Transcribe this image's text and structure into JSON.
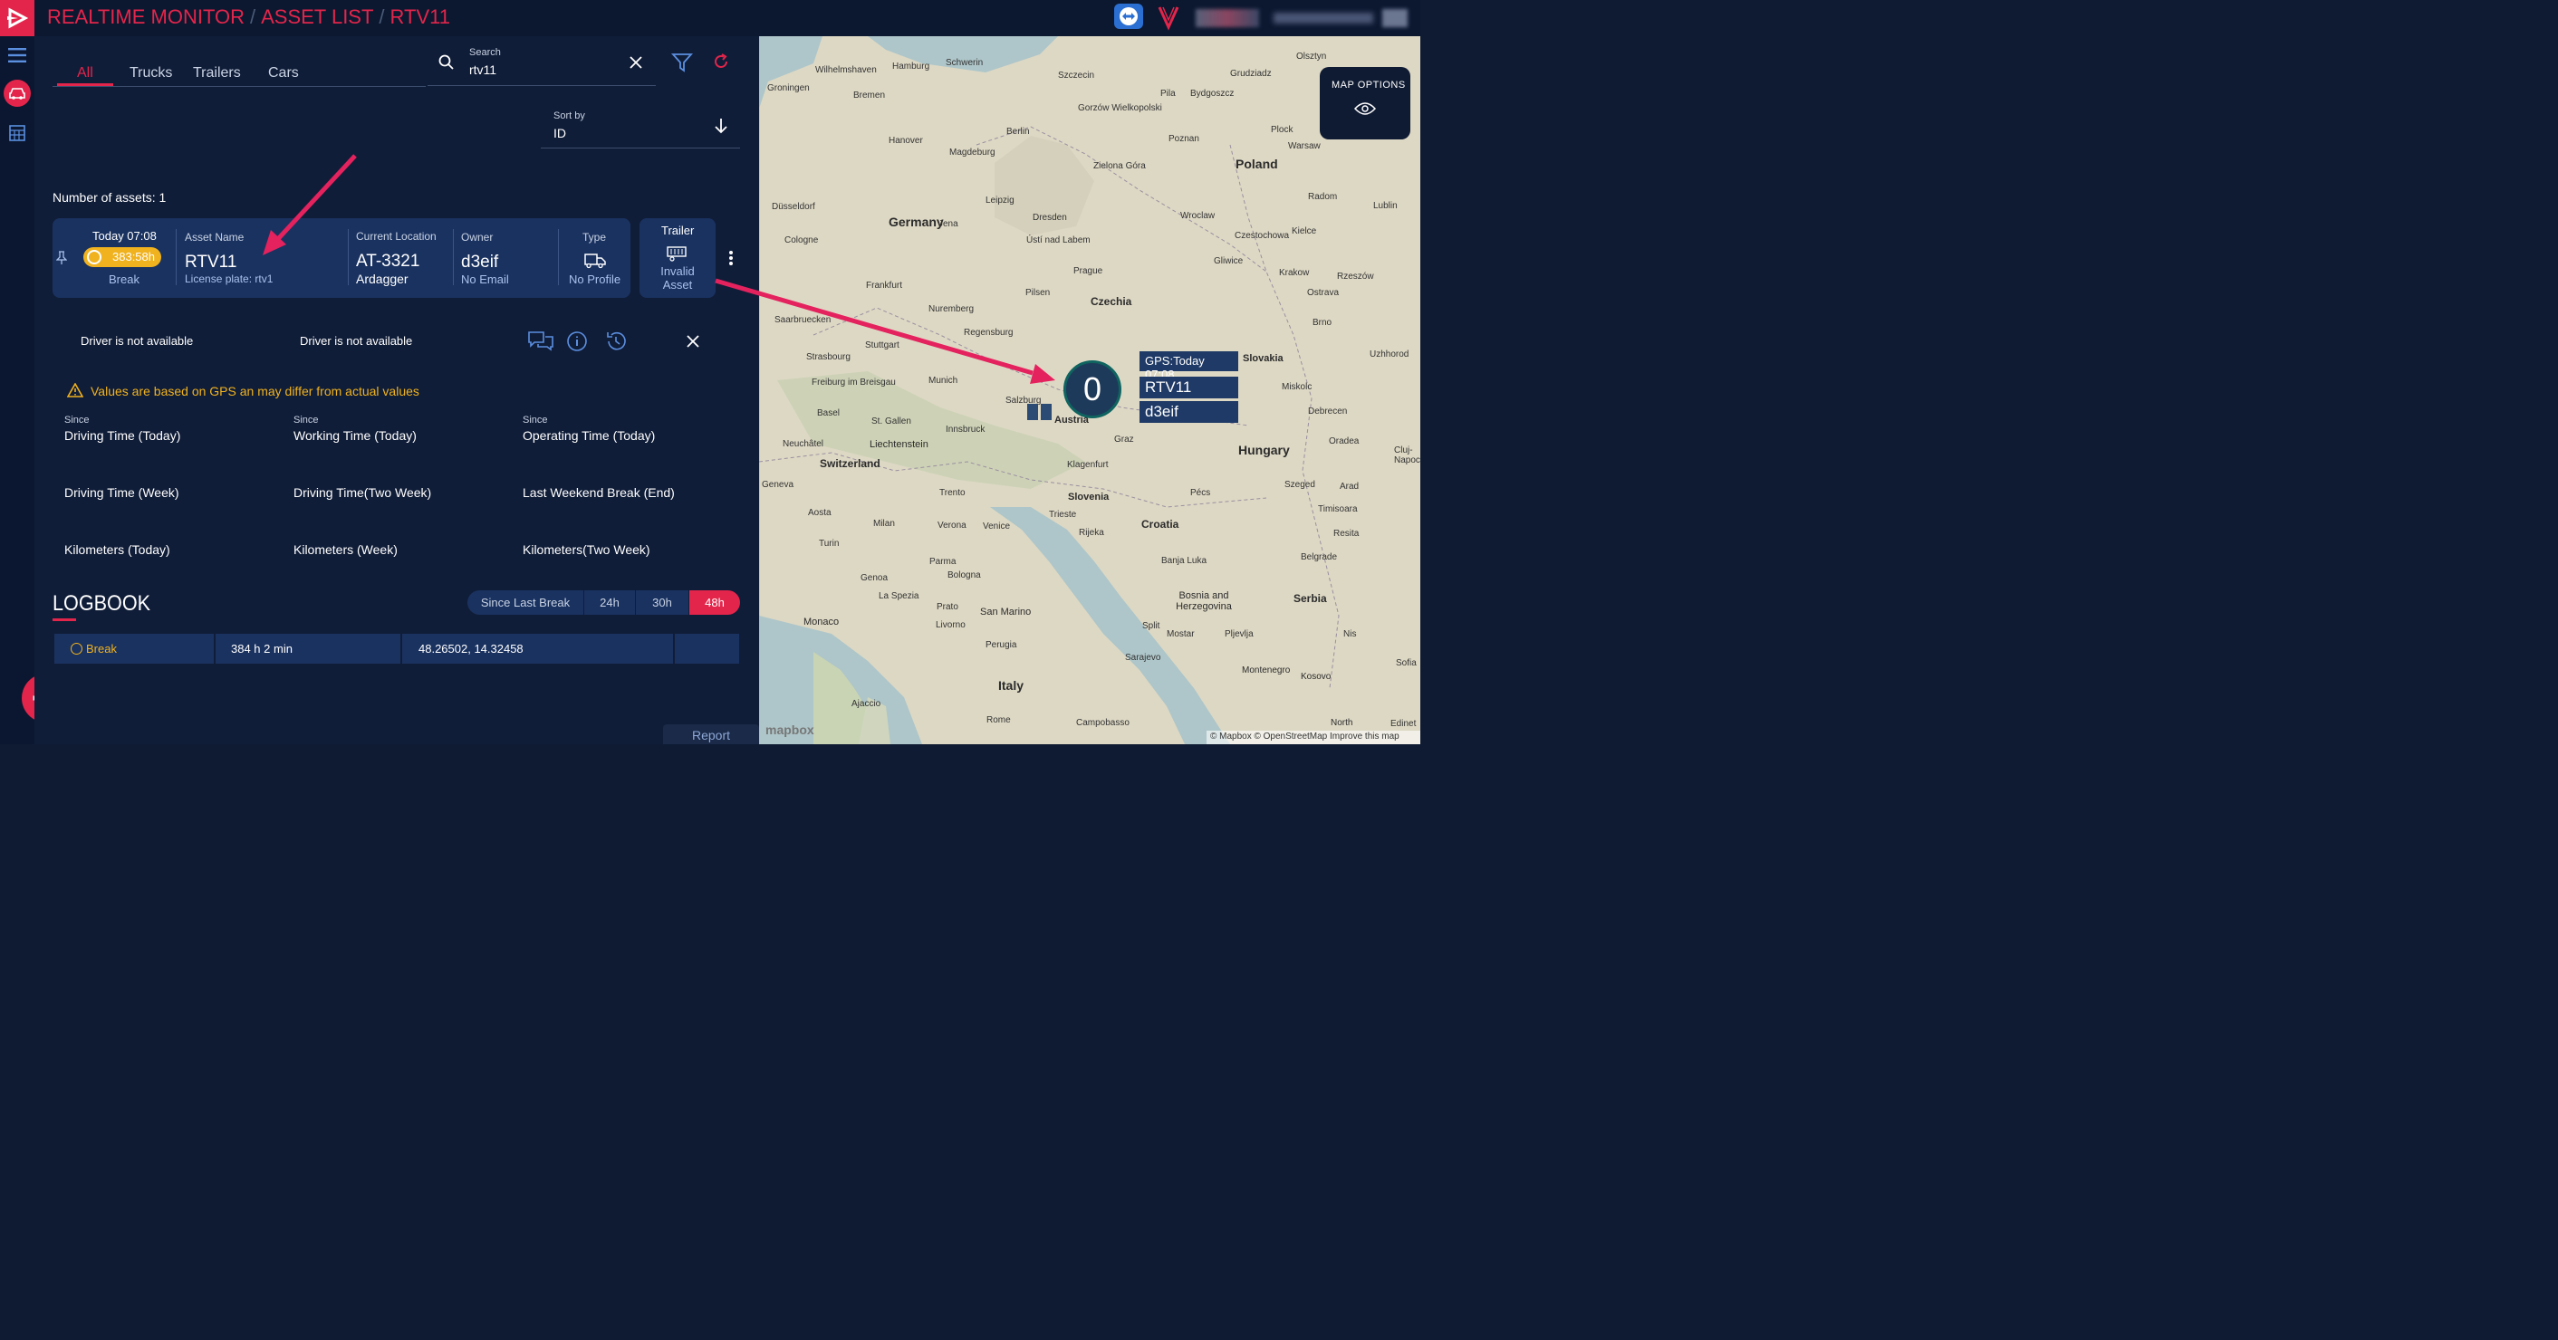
{
  "header": {
    "crumb1": "REALTIME MONITOR",
    "crumb2": "ASSET LIST",
    "crumb3": "RTV11",
    "sep": "/"
  },
  "tabs": [
    {
      "label": "All"
    },
    {
      "label": "Trucks"
    },
    {
      "label": "Trailers"
    },
    {
      "label": "Cars"
    }
  ],
  "search": {
    "label": "Search",
    "value": "rtv11"
  },
  "sort": {
    "label": "Sort by",
    "value": "ID"
  },
  "count_text": "Number of assets: 1",
  "asset": {
    "time": "Today 07:08",
    "duration": "383:58h",
    "status": "Break",
    "name_label": "Asset Name",
    "name": "RTV11",
    "plate": "License plate: rtv1",
    "loc_label": "Current Location",
    "loc": "AT-3321",
    "loc_city": "Ardagger",
    "owner_label": "Owner",
    "owner": "d3eif",
    "owner_email": "No Email",
    "type_label": "Type",
    "type_value": "No Profile",
    "trailer_label": "Trailer",
    "trailer_value": "Invalid Asset"
  },
  "drivers": [
    "Driver is not available",
    "Driver is not available"
  ],
  "warning": "Values are based on GPS an may differ from actual values",
  "stats": [
    {
      "since": "Since",
      "label": "Driving Time (Today)"
    },
    {
      "since": "Since",
      "label": "Working Time (Today)"
    },
    {
      "since": "Since",
      "label": "Operating Time (Today)"
    },
    {
      "since": "",
      "label": "Driving Time (Week)"
    },
    {
      "since": "",
      "label": "Driving Time(Two Week)"
    },
    {
      "since": "",
      "label": "Last Weekend Break (End)"
    },
    {
      "since": "",
      "label": "Kilometers (Today)"
    },
    {
      "since": "",
      "label": "Kilometers (Week)"
    },
    {
      "since": "",
      "label": "Kilometers(Two Week)"
    }
  ],
  "logbook": {
    "title": "LOGBOOK",
    "ranges": [
      "Since Last Break",
      "24h",
      "30h",
      "48h"
    ],
    "active_range": "48h",
    "row": {
      "type": "Break",
      "duration": "384 h 2 min",
      "coords": "48.26502, 14.32458"
    }
  },
  "report_label": "Report",
  "map": {
    "options_label": "MAP OPTIONS",
    "marker_count": "0",
    "gps": "GPS:Today 07:08",
    "asset": "RTV11",
    "owner": "d3eif",
    "attribution": "© Mapbox © OpenStreetMap Improve this map",
    "mapbox": "mapbox",
    "countries": [
      "Germany",
      "Poland",
      "Czechia",
      "Austria",
      "Slovakia",
      "Hungary",
      "Switzerland",
      "Liechtenstein",
      "Slovenia",
      "Croatia",
      "Bosnia and Herzegovina",
      "Serbia",
      "Italy",
      "San Marino",
      "Monaco",
      "Montenegro",
      "Kosovo",
      "North"
    ],
    "cities": [
      "Hamburg",
      "Schwerin",
      "Szczecin",
      "Olsztyn",
      "Wilhelmshaven",
      "Bremen",
      "Groningen",
      "Grudziadz",
      "Bydgoszcz",
      "Pila",
      "Gorzów Wielkopolski",
      "Berlin",
      "Poznan",
      "Hanover",
      "Plock",
      "Warsaw",
      "Magdeburg",
      "Zielona Góra",
      "Leipzig",
      "Radom",
      "Lublin",
      "Wroclaw",
      "Düsseldorf",
      "Cologne",
      "Dresden",
      "Jena",
      "Ústí nad Labem",
      "Kielce",
      "Czestochowa",
      "Frankfurt",
      "Prague",
      "Gliwice",
      "Krakow",
      "Rzeszów",
      "Pilsen",
      "Ostrava",
      "Nuremberg",
      "Brno",
      "Saarbruecken",
      "Regensburg",
      "Stuttgart",
      "Strasbourg",
      "Uzhhorod",
      "Munich",
      "Freiburg im Breisgau",
      "Salzburg",
      "Miskolc",
      "Basel",
      "St. Gallen",
      "Innsbruck",
      "Debrecen",
      "Graz",
      "Neuchâtel",
      "Oradea",
      "Klagenfurt",
      "Cluj-Napoca",
      "Trento",
      "Geneva",
      "Aosta",
      "Milan",
      "Verona",
      "Venice",
      "Trieste",
      "Rijeka",
      "Pécs",
      "Szeged",
      "Arad",
      "Timisoara",
      "Turin",
      "Parma",
      "Resita",
      "Genoa",
      "Bologna",
      "Banja Luka",
      "Belgrade",
      "La Spezia",
      "Prato",
      "Livorno",
      "Split",
      "Mostar",
      "Pljevlja",
      "Nis",
      "Perugia",
      "Ajaccio",
      "Rome",
      "Campobasso",
      "Sofia",
      "Edinet",
      "Sarajevo"
    ]
  },
  "colors": {
    "accent": "#e3254b",
    "panel": "#101d38",
    "card": "#1a3260",
    "warning": "#f0b21e",
    "map_bg": "#dcd7c2"
  }
}
